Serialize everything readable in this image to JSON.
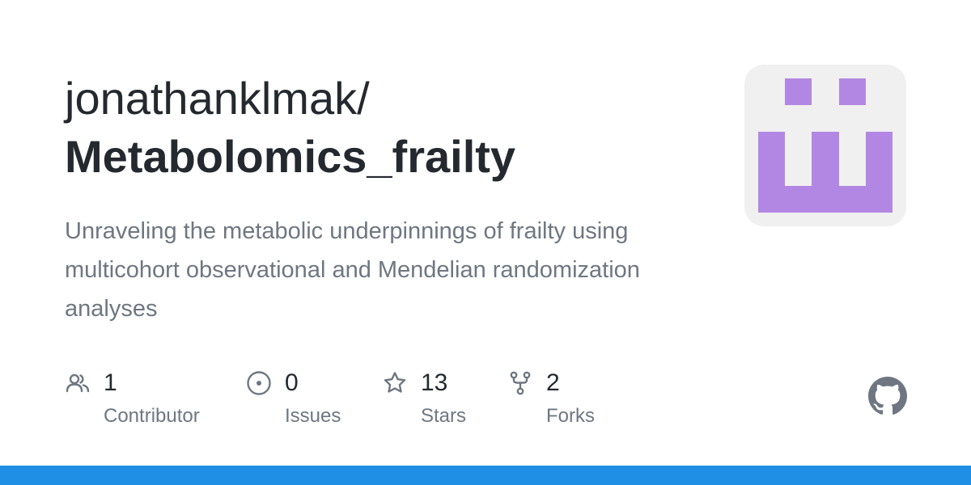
{
  "repo": {
    "owner": "jonathanklmak/",
    "name": "Metabolomics_frailty",
    "description": "Unraveling the metabolic underpinnings of frailty using multicohort observational and Mendelian randomization analyses"
  },
  "avatar": {
    "icon": "identicon",
    "color": "#b287e3",
    "background": "#f0f0f0"
  },
  "stats": {
    "contributors": {
      "value": "1",
      "label": "Contributor",
      "icon": "people-icon"
    },
    "issues": {
      "value": "0",
      "label": "Issues",
      "icon": "issue-opened-icon"
    },
    "stars": {
      "value": "13",
      "label": "Stars",
      "icon": "star-icon"
    },
    "forks": {
      "value": "2",
      "label": "Forks",
      "icon": "repo-forked-icon"
    }
  },
  "brand": {
    "logo": "github-mark-icon",
    "bar_color": "#1f8fe5",
    "text_color": "#24292f",
    "muted_color": "#6e7781"
  }
}
